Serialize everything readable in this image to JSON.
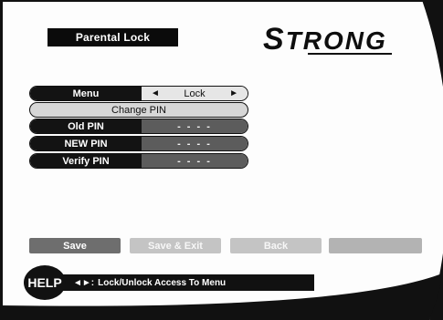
{
  "screen": {
    "title": "Parental Lock",
    "brand": "STRONG",
    "brand_initial": "S",
    "brand_rest": "TRONG"
  },
  "menu_rows": [
    {
      "label": "Menu",
      "value": "Lock",
      "left_arrow": "◄",
      "right_arrow": "►"
    },
    {
      "label": "Change PIN"
    },
    {
      "label": "Old PIN",
      "value": "- - - -"
    },
    {
      "label": "NEW PIN",
      "value": "- - - -"
    },
    {
      "label": "Verify PIN",
      "value": "- - - -"
    }
  ],
  "buttons": {
    "save": "Save",
    "save_exit": "Save & Exit",
    "back": "Back",
    "blank": ""
  },
  "help": {
    "badge": "HELP",
    "keys": "◄►:",
    "text": "Lock/Unlock Access To Menu"
  },
  "colors": {
    "black": "#111111",
    "dark_grey": "#5c5c5c",
    "light_grey": "#c4c4c4",
    "white": "#ffffff"
  },
  "icons": [
    "left-arrow-icon",
    "right-arrow-icon"
  ]
}
